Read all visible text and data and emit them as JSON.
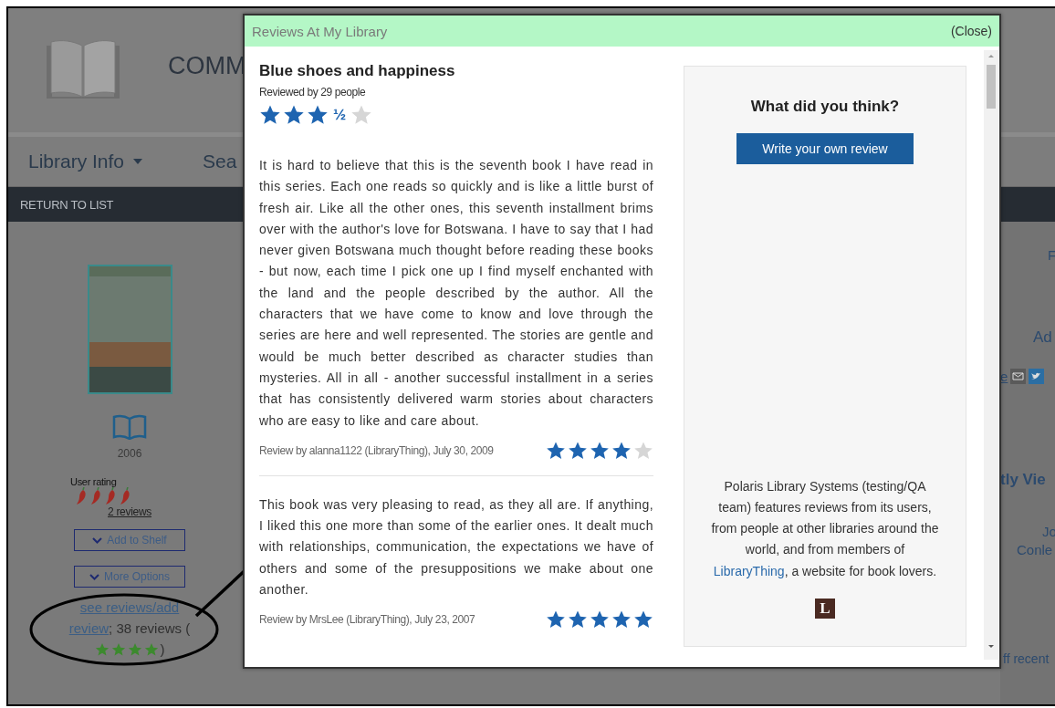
{
  "page": {
    "brand": "COMM",
    "nav": [
      {
        "label": "Library Info",
        "dropdown": true
      },
      {
        "label": "Sea"
      }
    ],
    "return_link": "RETURN TO LIST",
    "item": {
      "year": "2006",
      "user_rating": {
        "label": "User rating",
        "stars": 4,
        "link": "2 reviews"
      },
      "buttons": [
        "Add to Shelf",
        "More Options"
      ],
      "reviews_link": [
        "see reviews/add",
        "review"
      ],
      "reviews_count": "; 38 reviews (",
      "stars": 4,
      "close_paren": ")"
    },
    "side_fragments": [
      {
        "kind": "text",
        "text": "F"
      },
      {
        "kind": "text",
        "text": "Ad"
      },
      {
        "kind": "share",
        "text": "e"
      },
      {
        "kind": "heading",
        "text": "tly Vie"
      },
      {
        "kind": "text",
        "text": "Jo"
      },
      {
        "kind": "text",
        "text": "Conle"
      },
      {
        "kind": "text",
        "text": "ff recent"
      }
    ]
  },
  "dialog": {
    "title": "Reviews At My Library",
    "close": "(Close)",
    "book": {
      "title": "Blue shoes and happiness",
      "reviewed_by": "Reviewed by 29 people",
      "stars": 3,
      "half": "½"
    },
    "reviews": [
      {
        "text": "It is hard to believe that this is the seventh book I have read in this series. Each one reads so quickly and is like a little burst of fresh air. Like all the other ones, this seventh installment brims over with the author's love for Botswana. I have to say that I had never given Botswana much thought before reading these books - but now, each time I pick one up I find myself enchanted with the land and the people described by the author. All the characters that we have come to know and love through the series are here and well represented. The stories are gentle and would be much better described as character studies than mysteries. All in all - another successful installment in a series that has consistently delivered warm stories about characters who are easy to like and care about.",
        "byline": "Review by alanna1122 (LibraryThing), July 30, 2009",
        "stars": 4
      },
      {
        "text": "This book was very pleasing to read, as they all are. If anything, I liked this one more than some of the earlier ones. It dealt much with relationships, communication, the expectations we have of others and some of the presuppositions we make about one another.",
        "byline": "Review by MrsLee (LibraryThing), July 23, 2007",
        "stars": 5
      }
    ],
    "panel": {
      "heading": "What did you think?",
      "button": "Write your own review",
      "blurb_before": "Polaris Library Systems (testing/QA team) features reviews from its users, from people at other libraries around the world, and from members of",
      "blurb_link": "LibraryThing",
      "blurb_after": ", a website for book lovers.",
      "logo_letter": "L"
    }
  }
}
